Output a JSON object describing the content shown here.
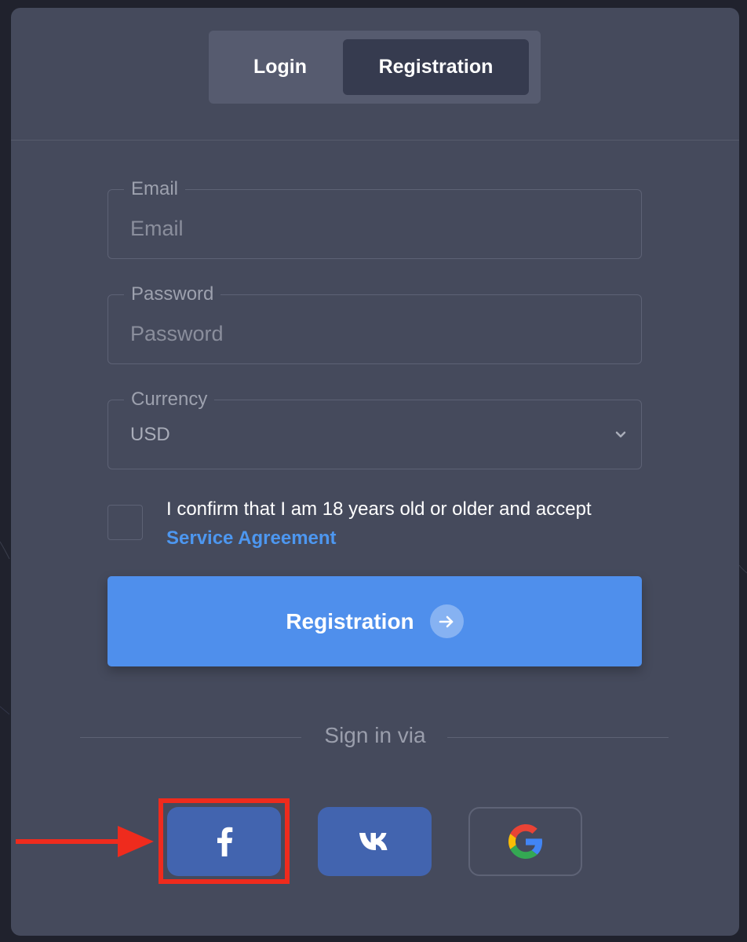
{
  "tabs": [
    {
      "label": "Login",
      "active": false
    },
    {
      "label": "Registration",
      "active": true
    }
  ],
  "form": {
    "email": {
      "label": "Email",
      "placeholder": "Email",
      "value": ""
    },
    "password": {
      "label": "Password",
      "placeholder": "Password",
      "value": ""
    },
    "currency": {
      "label": "Currency",
      "selected": "USD"
    },
    "confirm": {
      "text": "I confirm that I am 18 years old or older and accept",
      "link": "Service Agreement",
      "checked": false
    }
  },
  "submit": {
    "label": "Registration",
    "icon": "arrow-right-icon"
  },
  "social": {
    "heading": "Sign in via",
    "buttons": [
      {
        "name": "facebook",
        "icon": "facebook-icon"
      },
      {
        "name": "vk",
        "icon": "vk-icon"
      },
      {
        "name": "google",
        "icon": "google-icon"
      }
    ]
  },
  "colors": {
    "background": "#20222d",
    "panel": "#454a5c",
    "accent": "#4f8fec",
    "link": "#4d97f0",
    "social_button": "#4264af",
    "annotation": "#ef2b1d"
  }
}
